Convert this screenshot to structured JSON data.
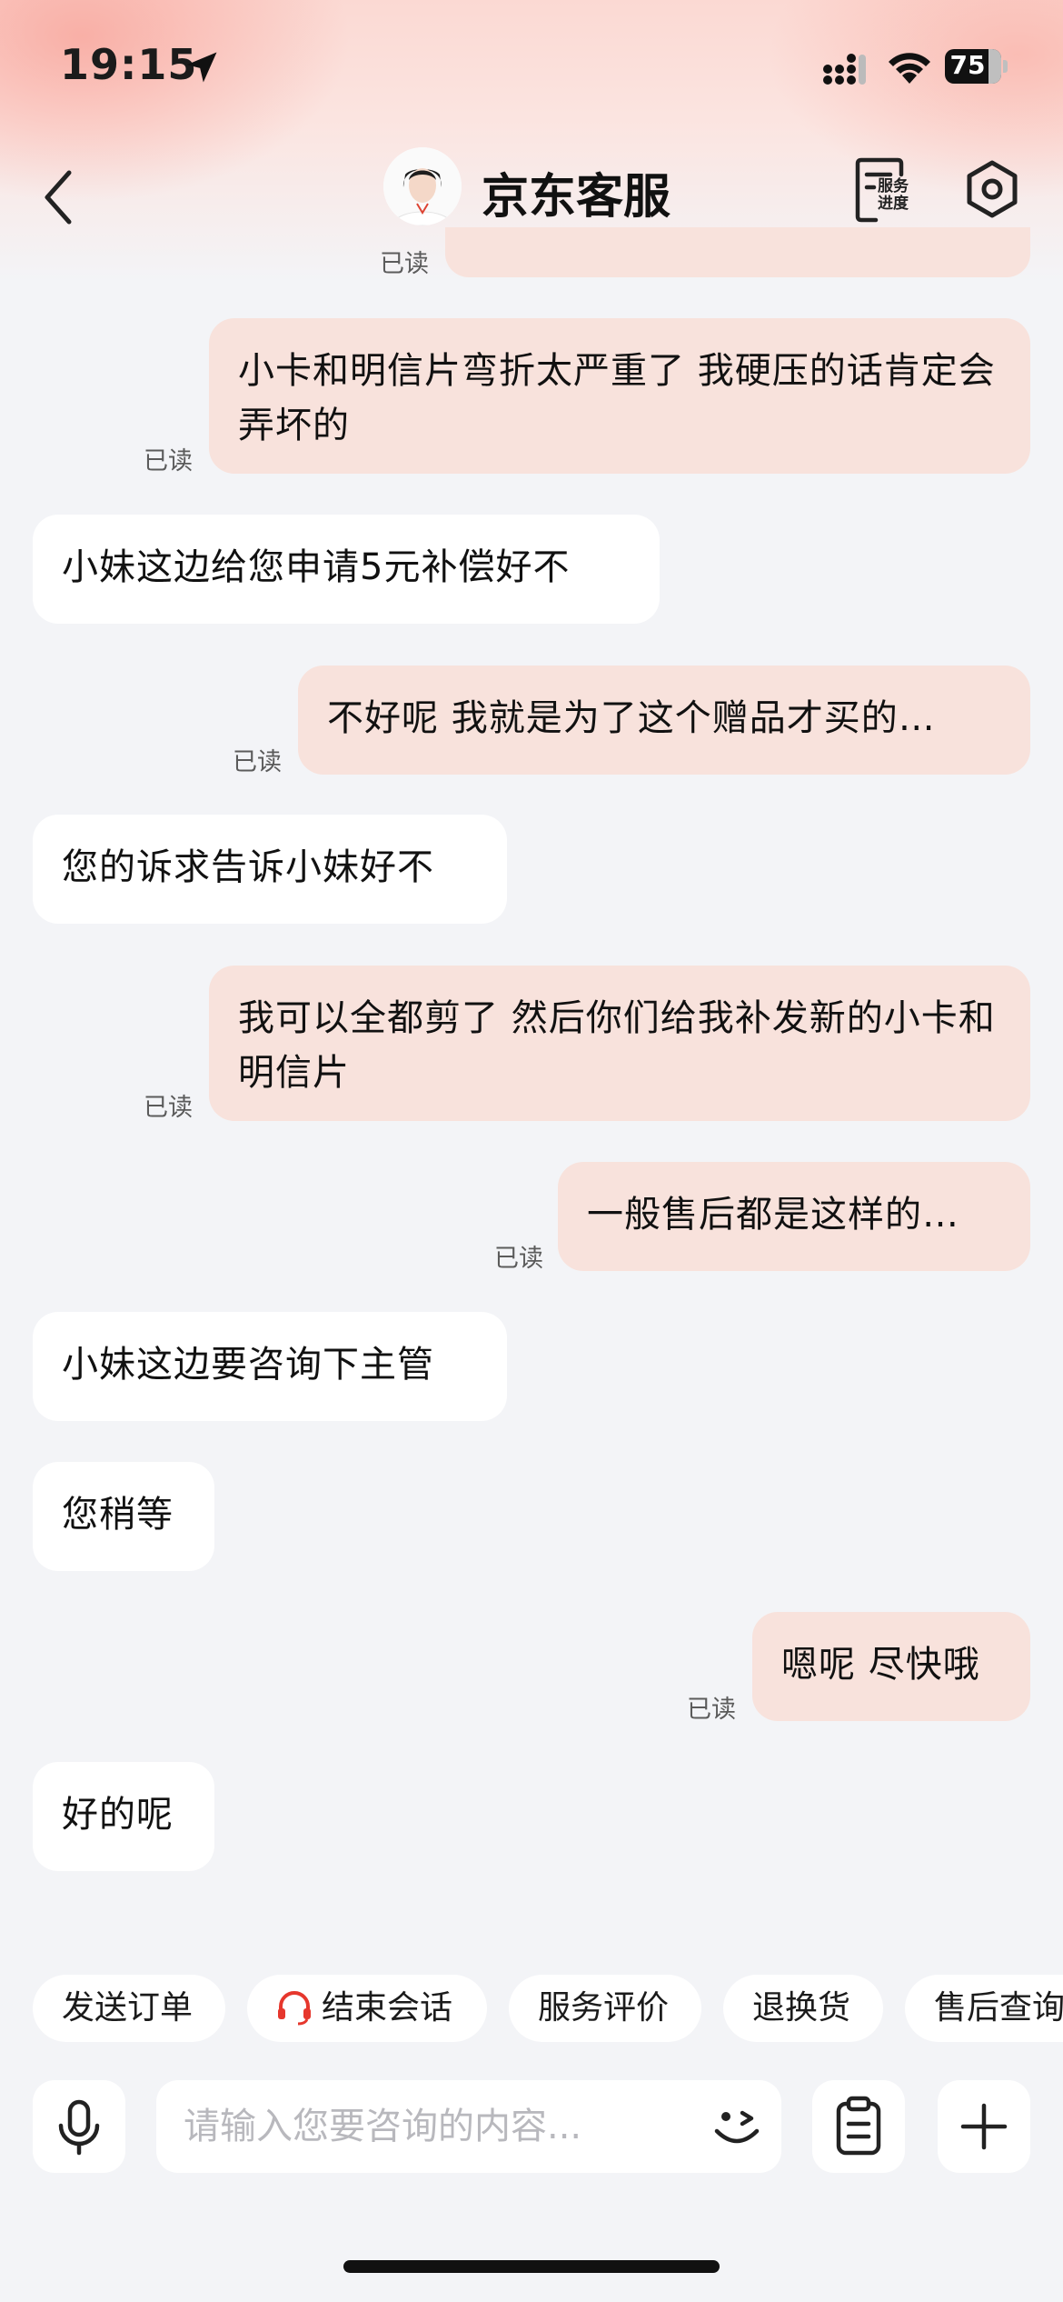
{
  "status_bar": {
    "time": "19:15",
    "battery": "75"
  },
  "header": {
    "title": "京东客服",
    "progress_label_1": "服务",
    "progress_label_2": "进度"
  },
  "read_label": "已读",
  "messages": [
    {
      "dir": "out",
      "text": "",
      "read": "已读"
    },
    {
      "dir": "out",
      "text": "小卡和明信片弯折太严重了 我硬压的话肯定会弄坏的",
      "read": "已读"
    },
    {
      "dir": "in",
      "text": "小妹这边给您申请5元补偿好不"
    },
    {
      "dir": "out",
      "text": "不好呢 我就是为了这个赠品才买的…",
      "read": "已读"
    },
    {
      "dir": "in",
      "text": "您的诉求告诉小妹好不"
    },
    {
      "dir": "out",
      "text": "我可以全都剪了 然后你们给我补发新的小卡和明信片",
      "read": "已读"
    },
    {
      "dir": "out",
      "text": "一般售后都是这样的…",
      "read": "已读"
    },
    {
      "dir": "in",
      "text": "小妹这边要咨询下主管"
    },
    {
      "dir": "in",
      "text": "您稍等"
    },
    {
      "dir": "out",
      "text": "嗯呢 尽快哦",
      "read": "已读"
    },
    {
      "dir": "in",
      "text": "好的呢"
    }
  ],
  "quick_actions": [
    "发送订单",
    "结束会话",
    "服务评价",
    "退换货",
    "售后查询"
  ],
  "input": {
    "placeholder": "请输入您要咨询的内容..."
  },
  "colors": {
    "outgoing_bubble": "#f8e2dc",
    "incoming_bubble": "#ffffff",
    "background": "#f3f4f7",
    "accent": "#e6372d"
  }
}
